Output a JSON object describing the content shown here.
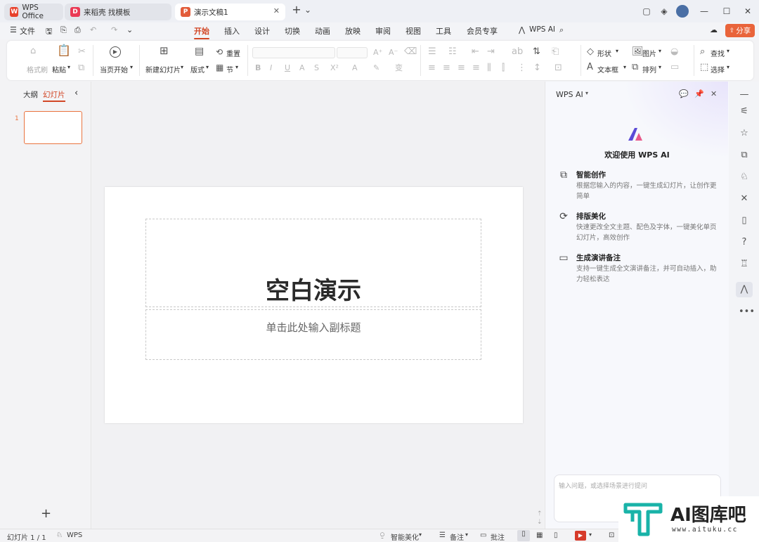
{
  "titlebar": {
    "tabs": [
      {
        "label": "WPS Office",
        "state": "inactive"
      },
      {
        "label": "来稻壳 找模板",
        "state": "inactive"
      },
      {
        "label": "演示文稿1",
        "state": "active"
      }
    ],
    "new_tab": "+",
    "new_tab_arrow": "⌄"
  },
  "menu": {
    "file": "文件",
    "tabs": [
      "开始",
      "插入",
      "设计",
      "切换",
      "动画",
      "放映",
      "审阅",
      "视图",
      "工具",
      "会员专享"
    ],
    "active_tab": "开始",
    "wps_ai": "WPS AI",
    "share": "分享"
  },
  "ribbon": {
    "format_painter": "格式刷",
    "paste": "粘贴",
    "play_from_current": "当页开始",
    "new_slide": "新建幻灯片",
    "layout": "版式",
    "reset": "重置",
    "section": "节",
    "shape": "形状",
    "picture": "图片",
    "textbox": "文本框",
    "arrange": "排列",
    "find": "查找",
    "select": "选择"
  },
  "left_panel": {
    "tabs": [
      "大纲",
      "幻灯片"
    ],
    "active_tab": "幻灯片",
    "slide_numbers": [
      "1"
    ],
    "add": "+"
  },
  "slide": {
    "title": "空白演示",
    "subtitle_placeholder": "单击此处输入副标题"
  },
  "ai_panel": {
    "header": "WPS AI",
    "welcome": "欢迎使用 WPS AI",
    "features": [
      {
        "title": "智能创作",
        "desc": "根据您输入的内容，一键生成幻灯片，让创作更简单",
        "icon": "smart-create-icon"
      },
      {
        "title": "排版美化",
        "desc": "快速更改全文主题、配色及字体，一键美化单页幻灯片，高效创作",
        "icon": "beautify-icon"
      },
      {
        "title": "生成演讲备注",
        "desc": "支持一键生成全文演讲备注，并可自动插入，助力轻松表达",
        "icon": "speech-notes-icon"
      }
    ],
    "input_placeholder": "输入问题，或选择场景进行提问"
  },
  "statusbar": {
    "slide_count": "幻灯片 1 / 1",
    "theme": "WPS",
    "smart_beautify": "智能美化",
    "notes": "备注",
    "comments": "批注"
  },
  "watermark": {
    "brand": "AI图库吧",
    "url": "www.aituku.cc"
  },
  "colors": {
    "accent": "#d24726",
    "share": "#e9643b",
    "thumb_border": "#e9733f",
    "ai_logo": "#5b4bd6"
  }
}
